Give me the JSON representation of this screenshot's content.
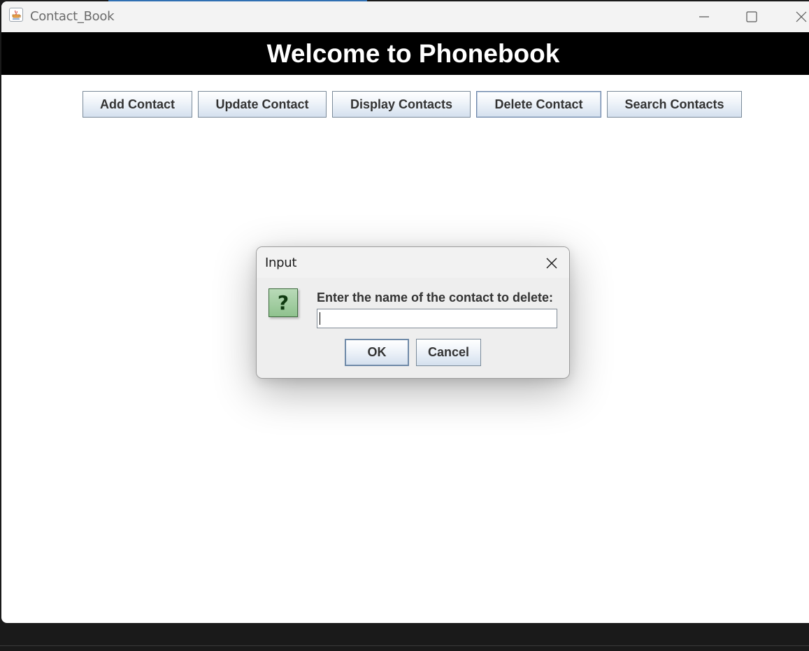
{
  "window": {
    "title": "Contact_Book",
    "app_icon": "java-cup-icon",
    "controls": [
      "minimize-icon",
      "maximize-icon",
      "close-icon"
    ]
  },
  "header": {
    "title": "Welcome to Phonebook"
  },
  "toolbar": {
    "buttons": [
      {
        "label": "Add Contact"
      },
      {
        "label": "Update Contact"
      },
      {
        "label": "Display Contacts"
      },
      {
        "label": "Delete Contact",
        "focused": true
      },
      {
        "label": "Search Contacts"
      }
    ]
  },
  "dialog": {
    "title": "Input",
    "icon": "question-icon",
    "icon_glyph": "?",
    "prompt": "Enter the name of the contact to delete:",
    "input_value": "",
    "ok_label": "OK",
    "cancel_label": "Cancel"
  },
  "colors": {
    "header_background": "#000000",
    "header_text": "#ffffff",
    "button_gradient_top": "#ffffff",
    "button_gradient_bottom": "#d4e0ee",
    "question_icon_green": "#8fc28e"
  }
}
